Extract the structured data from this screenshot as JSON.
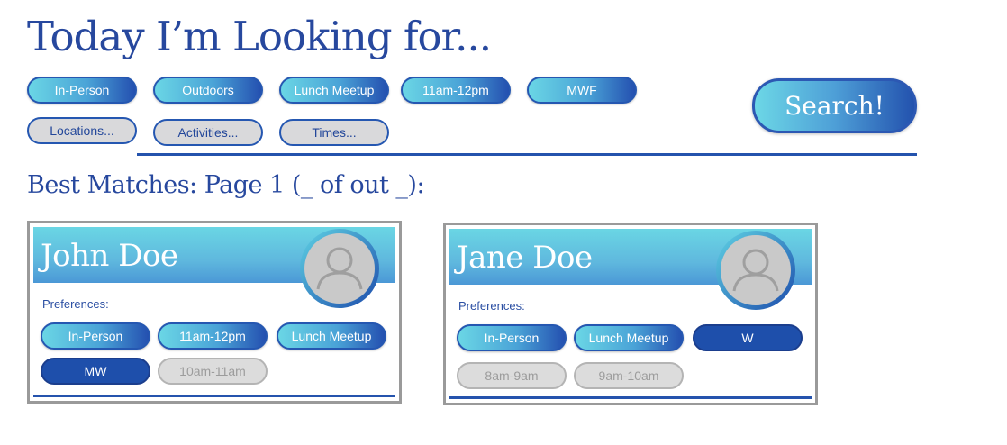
{
  "title": "Today I’m Looking for...",
  "filters": {
    "chips": [
      "In-Person",
      "Outdoors",
      "Lunch Meetup",
      "11am-12pm",
      "MWF"
    ],
    "dropdowns": [
      "Locations...",
      "Activities...",
      "Times..."
    ]
  },
  "search_label": "Search!",
  "matches_heading": "Best Matches: Page 1 (_ of out _):",
  "cards": [
    {
      "name": "John Doe",
      "preferences_label": "Preferences:",
      "tags": [
        "In-Person",
        "11am-12pm",
        "Lunch Meetup",
        "MW",
        "10am-11am"
      ]
    },
    {
      "name": "Jane Doe",
      "preferences_label": "Preferences:",
      "tags": [
        "In-Person",
        "Lunch Meetup",
        "W",
        "8am-9am",
        "9am-10am"
      ]
    }
  ],
  "colors": {
    "primary": "#27489e",
    "accent_light": "#6ad6e5",
    "accent_dark": "#1e4fab",
    "muted": "#d9d9db"
  },
  "icons": {
    "avatar": "user-placeholder-icon"
  }
}
